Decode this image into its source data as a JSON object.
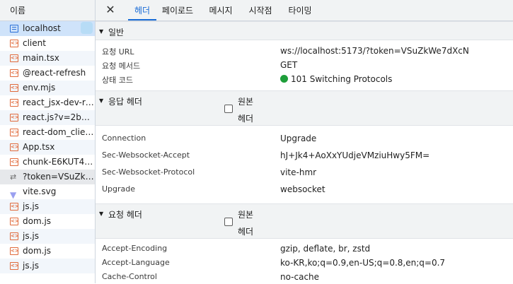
{
  "request_list": {
    "header": "이름",
    "items": [
      {
        "name": "localhost",
        "icon": "document-icon"
      },
      {
        "name": "client",
        "icon": "script-icon"
      },
      {
        "name": "main.tsx",
        "icon": "script-icon"
      },
      {
        "name": "@react-refresh",
        "icon": "script-icon"
      },
      {
        "name": "env.mjs",
        "icon": "script-icon"
      },
      {
        "name": "react_jsx-dev-ru...",
        "icon": "script-icon"
      },
      {
        "name": "react.js?v=2b9e...",
        "icon": "script-icon"
      },
      {
        "name": "react-dom_client...",
        "icon": "script-icon"
      },
      {
        "name": "App.tsx",
        "icon": "script-icon"
      },
      {
        "name": "chunk-E6KUT42...",
        "icon": "script-icon"
      },
      {
        "name": "?token=VSuZkW...",
        "icon": "websocket-icon"
      },
      {
        "name": "vite.svg",
        "icon": "svg-icon"
      },
      {
        "name": "js.js",
        "icon": "script-icon"
      },
      {
        "name": "dom.js",
        "icon": "script-icon"
      },
      {
        "name": "js.js",
        "icon": "script-icon"
      },
      {
        "name": "dom.js",
        "icon": "script-icon"
      },
      {
        "name": "js.js",
        "icon": "script-icon"
      }
    ]
  },
  "tabs": {
    "close": "✕",
    "items": [
      "헤더",
      "페이로드",
      "메시지",
      "시작점",
      "타이밍"
    ],
    "active": "헤더"
  },
  "general": {
    "title": "일반",
    "rows": [
      {
        "key": "요청 URL",
        "value": "ws://localhost:5173/?token=VSuZkWe7dXcN"
      },
      {
        "key": "요청 메서드",
        "value": "GET"
      },
      {
        "key": "상태 코드",
        "value": "101 Switching Protocols"
      }
    ]
  },
  "response_headers": {
    "title": "응답 헤더",
    "raw_line1": "원본",
    "raw_line2": "헤더",
    "rows": [
      {
        "key": "Connection",
        "value": "Upgrade"
      },
      {
        "key": "Sec-Websocket-Accept",
        "value": "hJ+Jk4+AoXxYUdjeVMziuHwy5FM="
      },
      {
        "key": "Sec-Websocket-Protocol",
        "value": "vite-hmr"
      },
      {
        "key": "Upgrade",
        "value": "websocket"
      }
    ]
  },
  "request_headers": {
    "title": "요청 헤더",
    "raw_line1": "원본",
    "raw_line2": "헤더",
    "rows": [
      {
        "key": "Accept-Encoding",
        "value": "gzip, deflate, br, zstd"
      },
      {
        "key": "Accept-Language",
        "value": "ko-KR,ko;q=0.9,en-US;q=0.8,en;q=0.7"
      },
      {
        "key": "Cache-Control",
        "value": "no-cache"
      }
    ]
  },
  "colors": {
    "accent": "#1a6cd6",
    "status_ok": "#1e9e3a",
    "selected_row": "#cfe3fa"
  }
}
